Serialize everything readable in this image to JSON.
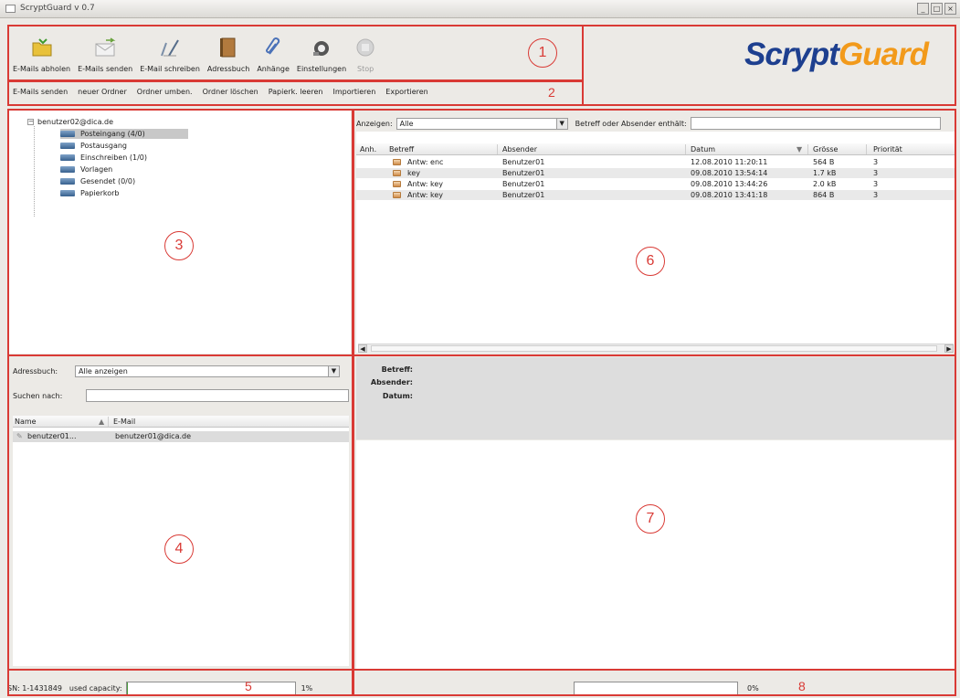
{
  "window": {
    "title": "ScryptGuard v 0.7",
    "controls": [
      "_",
      "□",
      "×"
    ]
  },
  "toolbar": {
    "buttons": [
      {
        "label": "E-Mails abholen",
        "icon": "folder-download-icon"
      },
      {
        "label": "E-Mails senden",
        "icon": "mail-send-icon"
      },
      {
        "label": "E-Mail schreiben",
        "icon": "pen-write-icon"
      },
      {
        "label": "Adressbuch",
        "icon": "address-book-icon"
      },
      {
        "label": "Anhänge",
        "icon": "paperclip-icon"
      },
      {
        "label": "Einstellungen",
        "icon": "settings-icon"
      },
      {
        "label": "Stop",
        "icon": "stop-icon",
        "disabled": true
      }
    ]
  },
  "logo": {
    "part1": "Scrypt",
    "part2": "Guard",
    "color1": "#1d3f8f",
    "color2": "#f29a1b"
  },
  "menubar": {
    "items": [
      "E-Mails senden",
      "neuer Ordner",
      "Ordner umben.",
      "Ordner löschen",
      "Papierk. leeren",
      "Importieren",
      "Exportieren"
    ]
  },
  "folders": {
    "account": "benutzer02@dica.de",
    "items": [
      {
        "label": "Posteingang (4/0)",
        "selected": true
      },
      {
        "label": "Postausgang"
      },
      {
        "label": "Einschreiben (1/0)"
      },
      {
        "label": "Vorlagen"
      },
      {
        "label": "Gesendet (0/0)"
      },
      {
        "label": "Papierkorb"
      }
    ]
  },
  "filter": {
    "show_label": "Anzeigen:",
    "show_value": "Alle",
    "search_label": "Betreff oder Absender enthält:",
    "search_value": ""
  },
  "messages": {
    "columns": [
      "Anh.",
      "Betreff",
      "Absender",
      "Datum",
      "Grösse",
      "Priorität"
    ],
    "rows": [
      {
        "subject": "Antw: enc",
        "sender": "Benutzer01",
        "date": "12.08.2010 11:20:11",
        "size": "564 B",
        "priority": "3"
      },
      {
        "subject": "key",
        "sender": "Benutzer01",
        "date": "09.08.2010 13:54:14",
        "size": "1.7 kB",
        "priority": "3"
      },
      {
        "subject": "Antw: key",
        "sender": "Benutzer01",
        "date": "09.08.2010 13:44:26",
        "size": "2.0 kB",
        "priority": "3"
      },
      {
        "subject": "Antw: key",
        "sender": "Benutzer01",
        "date": "09.08.2010 13:41:18",
        "size": "864 B",
        "priority": "3"
      }
    ]
  },
  "addressbook": {
    "label": "Adressbuch:",
    "select_value": "Alle anzeigen",
    "search_label": "Suchen nach:",
    "search_value": "",
    "columns": [
      "Name",
      "E-Mail"
    ],
    "contacts": [
      {
        "name": "benutzer01...",
        "email": "benutzer01@dica.de"
      }
    ]
  },
  "preview": {
    "subject_label": "Betreff:",
    "sender_label": "Absender:",
    "date_label": "Datum:"
  },
  "status": {
    "sn_text": "SN: 1-1431849",
    "capacity_label": "used capacity:",
    "capacity_percent": "1%",
    "capacity_fraction": 0.01,
    "progress_percent": "0%",
    "progress_fraction": 0
  },
  "callouts": [
    "1",
    "2",
    "3",
    "4",
    "5",
    "6",
    "7",
    "8"
  ],
  "accent": {
    "callout_red": "#d93a35"
  }
}
